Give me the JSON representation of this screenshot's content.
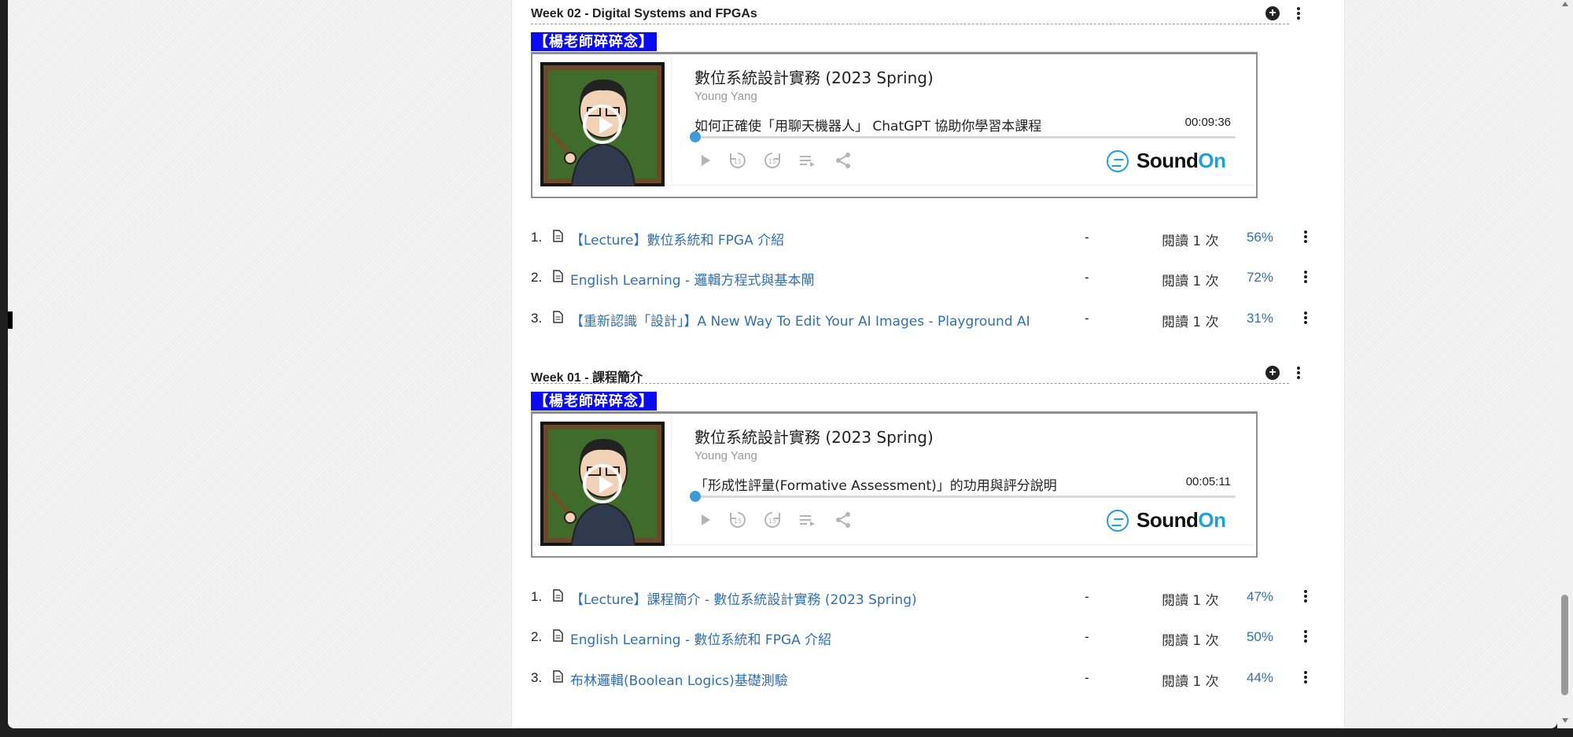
{
  "weeks": [
    {
      "title": "Week 02 - Digital Systems and FPGAs",
      "tag": "【楊老師碎碎念】",
      "player": {
        "podcast_title": "數位系統設計實務 (2023 Spring)",
        "author": "Young Yang",
        "episode_title": "如何正確使「用聊天機器人」 ChatGPT 協助你學習本課程",
        "duration": "00:09:36",
        "brand": "Sound",
        "brand_accent": "On"
      },
      "items": [
        {
          "num": "1.",
          "title": "【Lecture】數位系統和 FPGA 介紹",
          "dash": "-",
          "reads": "閱讀 1 次",
          "percent": "56%"
        },
        {
          "num": "2.",
          "title": "English Learning - 邏輯方程式與基本閘",
          "dash": "-",
          "reads": "閱讀 1 次",
          "percent": "72%"
        },
        {
          "num": "3.",
          "title": "【重新認識「設計」】A New Way To Edit Your AI Images - Playground AI",
          "dash": "-",
          "reads": "閱讀 1 次",
          "percent": "31%"
        }
      ]
    },
    {
      "title": "Week 01 - 課程簡介",
      "tag": "【楊老師碎碎念】",
      "player": {
        "podcast_title": "數位系統設計實務 (2023 Spring)",
        "author": "Young Yang",
        "episode_title": "「形成性評量(Formative Assessment)」的功用與評分說明",
        "duration": "00:05:11",
        "brand": "Sound",
        "brand_accent": "On"
      },
      "items": [
        {
          "num": "1.",
          "title": "【Lecture】課程簡介 - 數位系統設計實務 (2023 Spring)",
          "dash": "-",
          "reads": "閱讀 1 次",
          "percent": "47%"
        },
        {
          "num": "2.",
          "title": "English Learning - 數位系統和 FPGA 介紹",
          "dash": "-",
          "reads": "閱讀 1 次",
          "percent": "50%"
        },
        {
          "num": "3.",
          "title": "布林邏輯(Boolean Logics)基礎測驗",
          "dash": "-",
          "reads": "閱讀 1 次",
          "percent": "44%"
        }
      ]
    }
  ],
  "icons": {
    "add": "plus-circle-icon",
    "menu": "more-vertical-icon",
    "document": "document-icon",
    "play": "play-icon",
    "rewind": "rewind-15-icon",
    "forward": "forward-15-icon",
    "playlist": "playlist-icon",
    "share": "share-icon"
  },
  "colors": {
    "tag_bg": "#0b0bf0",
    "link": "#2f6fb3",
    "progress_knob": "#3d9bd6",
    "soundon_accent": "#1ea0dc"
  }
}
